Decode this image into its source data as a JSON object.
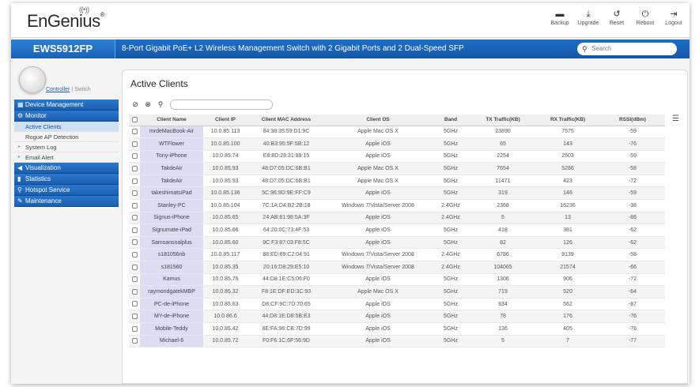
{
  "brand": {
    "name": "EnGenius",
    "mark": "®"
  },
  "tools": [
    {
      "label": "Backup",
      "icon": "backup-icon",
      "glyph": "▬"
    },
    {
      "label": "Upgrade",
      "icon": "upgrade-icon",
      "glyph": "⤓"
    },
    {
      "label": "Reset",
      "icon": "reset-icon",
      "glyph": "↺"
    },
    {
      "label": "Reboot",
      "icon": "reboot-icon",
      "glyph": "⏻"
    },
    {
      "label": "Logout",
      "icon": "logout-icon",
      "glyph": "⇥"
    }
  ],
  "header": {
    "model": "EWS5912FP",
    "description": "8-Port Gigabit PoE+ L2 Wireless Management Switch with 2 Gigabit Ports and 2 Dual-Speed SFP",
    "search_placeholder": "Search"
  },
  "switcher": {
    "controller": "Controller",
    "sep": " | ",
    "switch": "Switch"
  },
  "menu": [
    {
      "type": "head",
      "label": "Device Management",
      "icon": "device-icon",
      "glyph": "▦"
    },
    {
      "type": "head",
      "label": "Monitor",
      "icon": "monitor-icon",
      "glyph": "⚙"
    },
    {
      "type": "sub",
      "label": "Active Clients",
      "active": true
    },
    {
      "type": "sub",
      "label": "Rogue AP Detection"
    },
    {
      "type": "sub",
      "label": "System Log",
      "caret": true
    },
    {
      "type": "sub",
      "label": "Email Alert",
      "caret": true
    },
    {
      "type": "head",
      "label": "Visualization",
      "icon": "visualization-icon",
      "glyph": "◀"
    },
    {
      "type": "head",
      "label": "Statistics",
      "icon": "statistics-icon",
      "glyph": "▮"
    },
    {
      "type": "head",
      "label": "Hotspot Service",
      "icon": "hotspot-icon",
      "glyph": "⚲"
    },
    {
      "type": "head",
      "label": "Maintenance",
      "icon": "maintenance-icon",
      "glyph": "✎"
    }
  ],
  "page": {
    "title": "Active Clients"
  },
  "columns": [
    "",
    "Client Name",
    "Client IP",
    "Client MAC Address",
    "Client OS",
    "Band",
    "TX Traffic(KB)",
    "RX Traffic(KB)",
    "RSSI(dBm)"
  ],
  "rows": [
    [
      "mrdeMacBook-Air",
      "10.0.85.113",
      "84:38:35:59:D1:9C",
      "Apple Mac OS X",
      "5GHz",
      "23890",
      "7575",
      "-59"
    ],
    [
      "WTFlower",
      "10.0.85.100",
      "40:B3:95:5F:5B:12",
      "Apple iOS",
      "5GHz",
      "65",
      "143",
      "-76"
    ],
    [
      "Tony-iPhone",
      "10.0.85.74",
      "E8:8D:28:31:89:15",
      "Apple iOS",
      "5GHz",
      "2254",
      "2603",
      "-59"
    ],
    [
      "TakdeAir",
      "10.0.85.93",
      "48:D7:05:DC:6B:B1",
      "Apple Mac OS X",
      "5GHz",
      "7654",
      "5286",
      "-58"
    ],
    [
      "TakdeAir",
      "10.0.85.93",
      "48:D7:05:DC:6B:B1",
      "Apple Mac OS X",
      "5GHz",
      "11471",
      "423",
      "-72"
    ],
    [
      "takeshimatsiPad",
      "10.0.85.136",
      "5C:96:9D:9E:FF:C9",
      "Apple iOS",
      "5GHz",
      "319",
      "146",
      "-59"
    ],
    [
      "Stanley-PC",
      "10.0.85.104",
      "7C:1A:D4:B2:2B:18",
      "Windows 7/Vista/Server 2008",
      "2.4GHz",
      "2368",
      "16236",
      "-38"
    ],
    [
      "Signus-iPhone",
      "10.0.85.65",
      "24:AB:81:98:5A:3F",
      "Apple iOS",
      "2.4GHz",
      "5",
      "13",
      "-86"
    ],
    [
      "Signumate-iPad",
      "10.0.85.66",
      "64:20:0C:73:4F:53",
      "Apple iOS",
      "5GHz",
      "418",
      "381",
      "-62"
    ],
    [
      "Samsansnalplus",
      "10.0.85.60",
      "9C:F3:87:03:F8:5C",
      "Apple iOS",
      "5GHz",
      "82",
      "126",
      "-62"
    ],
    [
      "s181056nb",
      "10.0.85.117",
      "88:ED:89:C2:04:91",
      "Windows 7/Vista/Server 2008",
      "2.4GHz",
      "6786",
      "9139",
      "-58"
    ],
    [
      "s181560",
      "10.0.85.35",
      "20:16:D8:29:E5:10",
      "Windows 7/Vista/Server 2008",
      "2.4GHz",
      "104065",
      "21574",
      "-66"
    ],
    [
      "Kamus",
      "10.0.85.76",
      "44:D8:1E:C5:06:F0",
      "Apple iOS",
      "5GHz",
      "1306",
      "906",
      "-72"
    ],
    [
      "raymondgatekMBP",
      "10.0.85.32",
      "F8:1E:DF:ED:3C:93",
      "Apple Mac OS X",
      "5GHz",
      "719",
      "520",
      "-64"
    ],
    [
      "PC-de-iPhone",
      "10.0.85.63",
      "D8:CF:9C:7D:70:65",
      "Apple iOS",
      "5GHz",
      "834",
      "562",
      "-87"
    ],
    [
      "MY-de-iPhone",
      "10.0.86.6",
      "44:D8:1E:D8:5B:E3",
      "Apple iOS",
      "5GHz",
      "78",
      "176",
      "-76"
    ],
    [
      "Mobile-Teddy",
      "10.0.85.42",
      "8E:FA:96:CB:7D:99",
      "Apple iOS",
      "5GHz",
      "136",
      "405",
      "-76"
    ],
    [
      "Michael-6",
      "10.0.85.72",
      "F0:F6:1C:6F:56:9D",
      "Apple iOS",
      "5GHz",
      "5",
      "7",
      "-77"
    ]
  ]
}
